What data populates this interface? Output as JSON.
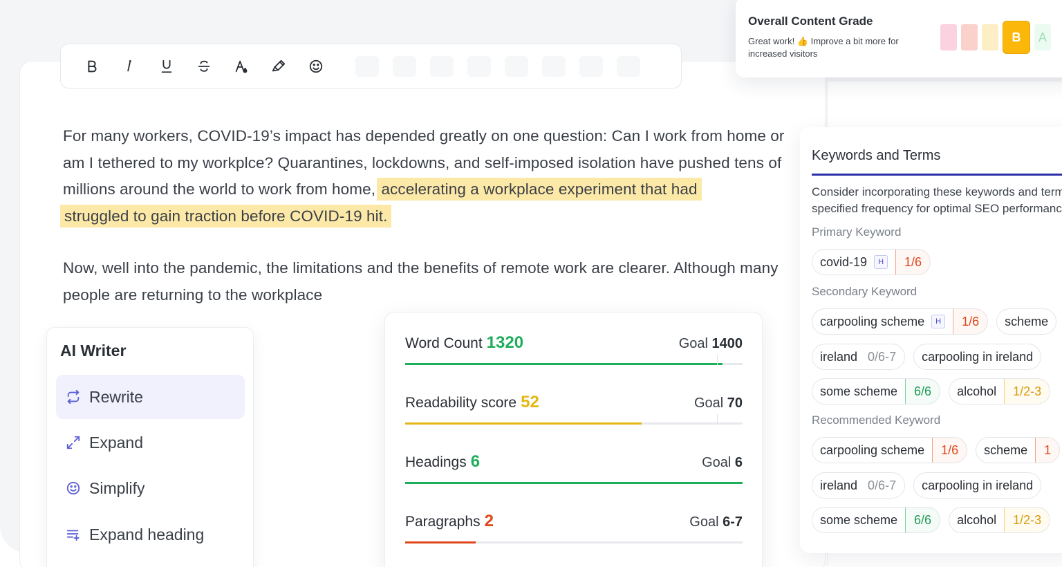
{
  "toolbar": {
    "buttons": [
      {
        "name": "bold-button",
        "icon": "bold-icon"
      },
      {
        "name": "italic-button",
        "icon": "italic-icon"
      },
      {
        "name": "underline-button",
        "icon": "underline-icon"
      },
      {
        "name": "strikethrough-button",
        "icon": "strikethrough-icon"
      },
      {
        "name": "text-color-button",
        "icon": "text-color-icon"
      },
      {
        "name": "highlight-button",
        "icon": "highlighter-icon"
      },
      {
        "name": "emoji-button",
        "icon": "emoji-icon"
      }
    ]
  },
  "document": {
    "p1_before": "For many workers, COVID-19’s impact has depended greatly on one question: Can I work from home or am I tethered to my workplce? Quarantines, lockdowns, and self-imposed isolation have pushed tens of millions around the world to work from home, ",
    "p1_highlight_a": "accelerating a workplace experiment that had ",
    "p1_highlight_b": "struggled to gain traction before COVID-19 hit.",
    "p2": "Now, well into the pandemic, the limitations and the benefits of remote work are clearer. Although many people are returning to the workplace",
    "highlight_color": "#fde9a7"
  },
  "ai_writer": {
    "title": "AI Writer",
    "items": [
      {
        "label": "Rewrite",
        "icon": "rewrite-icon",
        "active": true
      },
      {
        "label": "Expand",
        "icon": "expand-icon",
        "active": false
      },
      {
        "label": "Simplify",
        "icon": "simplify-icon",
        "active": false
      },
      {
        "label": "Expand heading",
        "icon": "expand-heading-icon",
        "active": false
      }
    ],
    "accent": "#5b5fd6"
  },
  "metrics": [
    {
      "label": "Word Count",
      "value": "1320",
      "goal_label": "Goal",
      "goal": "1400",
      "color": "#1fae5b",
      "progress": 0.94
    },
    {
      "label": "Readability score",
      "value": "52",
      "goal_label": "Goal",
      "goal": "70",
      "color": "#e5b612",
      "progress": 0.7
    },
    {
      "label": "Headings",
      "value": "6",
      "goal_label": "Goal",
      "goal": "6",
      "color": "#1fae5b",
      "progress": 1.0
    },
    {
      "label": "Paragraphs",
      "value": "2",
      "goal_label": "Goal",
      "goal": "6-7",
      "color": "#e0461b",
      "progress": 0.21
    }
  ],
  "grade": {
    "title": "Overall Content Grade",
    "subtitle": "Great work! 👍 Improve a bit more for increased visitors",
    "current": "B",
    "next": "A",
    "scale_colors": [
      "#fbd3e0",
      "#fbd2cb",
      "#fdeec6"
    ],
    "current_color": "#fbb80a"
  },
  "keywords": {
    "title": "Keywords and Terms",
    "description_1": "Consider incorporating these keywords and terms at the",
    "description_2": "specified frequency for optimal SEO performance.",
    "primary_label": "Primary Keyword",
    "secondary_label": "Secondary Keyword",
    "recommended_label": "Recommended Keyword",
    "h_badge": "H",
    "primary": [
      {
        "term": "covid-19",
        "heading": true,
        "count": "1/6",
        "status": "red"
      }
    ],
    "secondary": [
      [
        {
          "term": "carpooling scheme",
          "heading": true,
          "count": "1/6",
          "status": "red"
        },
        {
          "term": "scheme",
          "heading": false,
          "count": "",
          "status": "none"
        }
      ],
      [
        {
          "term": "ireland",
          "heading": false,
          "count": "0/6-7",
          "status": "grey"
        },
        {
          "term": "carpooling in ireland",
          "heading": false,
          "count": "",
          "status": "none"
        }
      ],
      [
        {
          "term": "some scheme",
          "heading": false,
          "count": "6/6",
          "status": "green"
        },
        {
          "term": "alcohol",
          "heading": false,
          "count": "1/2-3",
          "status": "yellow"
        }
      ]
    ],
    "recommended": [
      [
        {
          "term": "carpooling scheme",
          "heading": false,
          "count": "1/6",
          "status": "red"
        },
        {
          "term": "scheme",
          "heading": false,
          "count": "1",
          "status": "red"
        }
      ],
      [
        {
          "term": "ireland",
          "heading": false,
          "count": "0/6-7",
          "status": "grey"
        },
        {
          "term": "carpooling in ireland",
          "heading": false,
          "count": "",
          "status": "none"
        }
      ],
      [
        {
          "term": "some scheme",
          "heading": false,
          "count": "6/6",
          "status": "green"
        },
        {
          "term": "alcohol",
          "heading": false,
          "count": "1/2-3",
          "status": "yellow"
        }
      ]
    ],
    "underline_color": "#2b2fa8"
  }
}
